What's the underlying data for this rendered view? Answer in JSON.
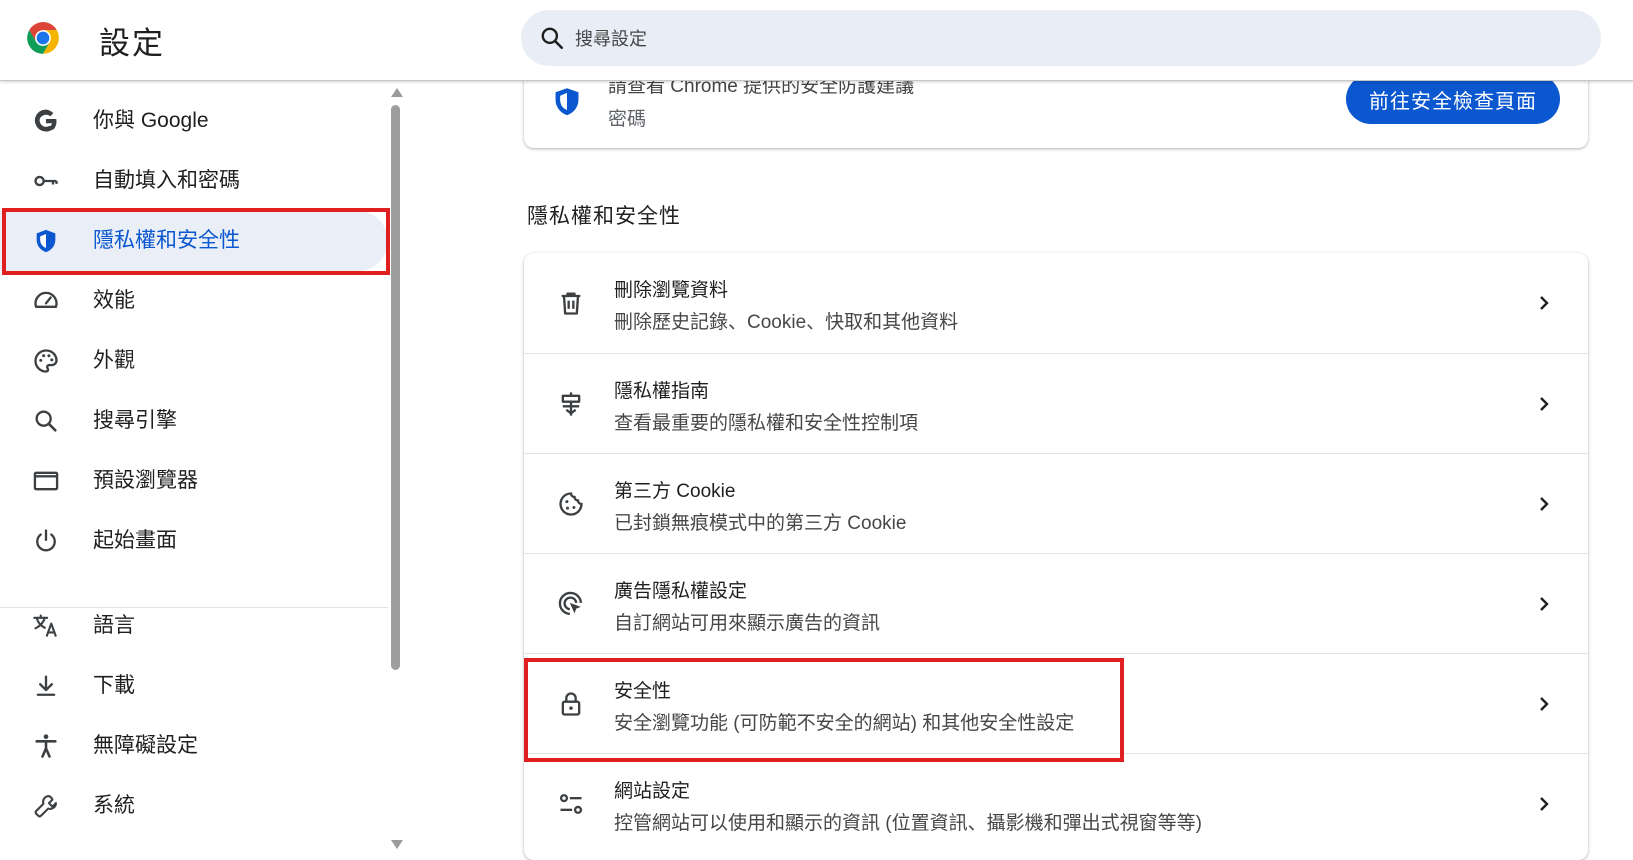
{
  "header": {
    "title": "設定",
    "search_placeholder": "搜尋設定"
  },
  "sidebar": {
    "items": [
      {
        "label": "你與 Google",
        "icon": "google-g-icon"
      },
      {
        "label": "自動填入和密碼",
        "icon": "key-icon"
      },
      {
        "label": "隱私權和安全性",
        "icon": "shield-icon",
        "active": true
      },
      {
        "label": "效能",
        "icon": "speedometer-icon"
      },
      {
        "label": "外觀",
        "icon": "palette-icon"
      },
      {
        "label": "搜尋引擎",
        "icon": "search-icon"
      },
      {
        "label": "預設瀏覽器",
        "icon": "browser-window-icon"
      },
      {
        "label": "起始畫面",
        "icon": "power-icon"
      },
      {
        "label": "語言",
        "icon": "translate-icon"
      },
      {
        "label": "下載",
        "icon": "download-icon"
      },
      {
        "label": "無障礙設定",
        "icon": "accessibility-icon"
      },
      {
        "label": "系統",
        "icon": "wrench-icon"
      }
    ]
  },
  "safety_card": {
    "line1": "請查看 Chrome 提供的安全防護建議",
    "line2": "密碼",
    "button_label": "前往安全檢查頁面"
  },
  "privacy_section": {
    "title": "隱私權和安全性",
    "rows": [
      {
        "title": "刪除瀏覽資料",
        "subtitle": "刪除歷史記錄、Cookie、快取和其他資料",
        "icon": "trash-icon"
      },
      {
        "title": "隱私權指南",
        "subtitle": "查看最重要的隱私權和安全性控制項",
        "icon": "privacy-guide-icon"
      },
      {
        "title": "第三方 Cookie",
        "subtitle": "已封鎖無痕模式中的第三方 Cookie",
        "icon": "cookie-icon"
      },
      {
        "title": "廣告隱私權設定",
        "subtitle": "自訂網站可用來顯示廣告的資訊",
        "icon": "ad-privacy-icon"
      },
      {
        "title": "安全性",
        "subtitle": "安全瀏覽功能 (可防範不安全的網站) 和其他安全性設定",
        "icon": "lock-icon"
      },
      {
        "title": "網站設定",
        "subtitle": "控管網站可以使用和顯示的資訊 (位置資訊、攝影機和彈出式視窗等等)",
        "icon": "site-settings-icon"
      }
    ]
  },
  "colors": {
    "accent": "#0b57d0",
    "active_bg": "#e9eef7",
    "search_bg": "#e9eef6",
    "highlight_box": "#e02020"
  }
}
